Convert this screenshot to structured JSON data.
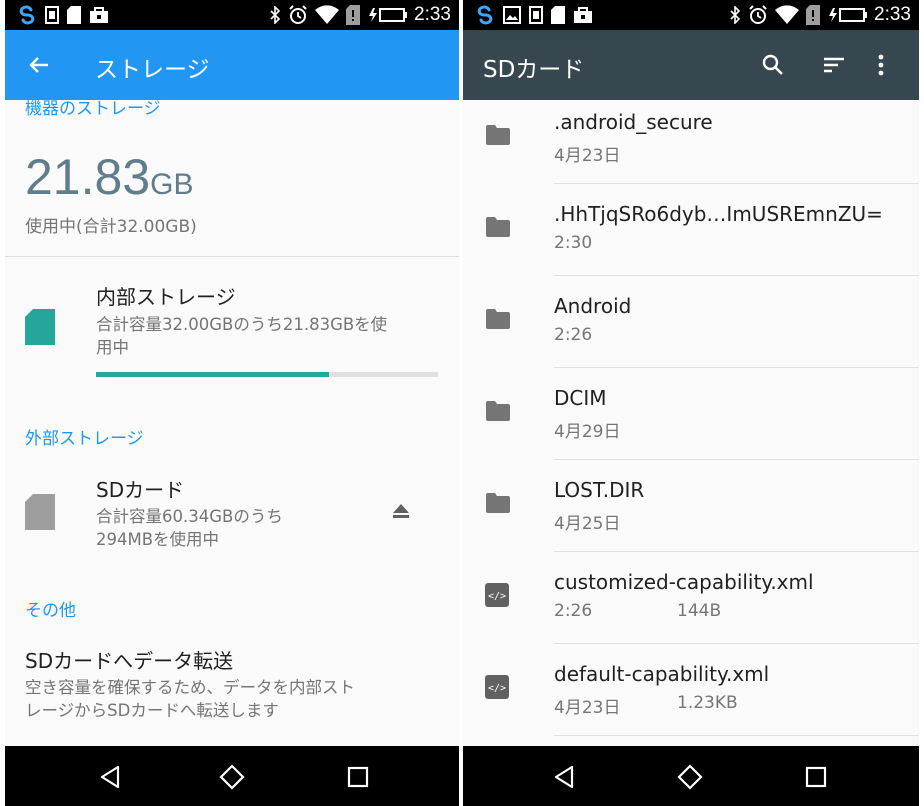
{
  "status_bar": {
    "time": "2:33"
  },
  "left": {
    "appbar": {
      "title": "ストレージ"
    },
    "device_section": {
      "label": "機器のストレージ"
    },
    "usage": {
      "value": "21.83",
      "unit": "GB",
      "caption": "使用中(合計32.00GB)"
    },
    "internal": {
      "title": "内部ストレージ",
      "subtitle_line1": "合計容量32.00GBのうち21.83GBを使",
      "subtitle_line2": "用中",
      "used_fraction": 0.6822
    },
    "external_section": {
      "label": "外部ストレージ"
    },
    "sd": {
      "title": "SDカード",
      "subtitle_line1": "合計容量60.34GBのうち",
      "subtitle_line2": "294MBを使用中"
    },
    "other_section": {
      "label": "その他"
    },
    "transfer": {
      "title": "SDカードへデータ転送",
      "subtitle_line1": "空き容量を確保するため、データを内部スト",
      "subtitle_line2": "レージからSDカードへ転送します"
    }
  },
  "right": {
    "appbar": {
      "title": "SDカード"
    },
    "files": [
      {
        "name": ".android_secure",
        "date": "4月23日",
        "size": "",
        "icon": "folder-icon"
      },
      {
        "name": ".HhTjqSRo6dyb…ImUSREmnZU=",
        "date": "2:30",
        "size": "",
        "icon": "folder-icon"
      },
      {
        "name": "Android",
        "date": "2:26",
        "size": "",
        "icon": "folder-icon"
      },
      {
        "name": "DCIM",
        "date": "4月29日",
        "size": "",
        "icon": "folder-icon"
      },
      {
        "name": "LOST.DIR",
        "date": "4月25日",
        "size": "",
        "icon": "folder-icon"
      },
      {
        "name": "customized-capability.xml",
        "date": "2:26",
        "size": "144B",
        "icon": "xml-file-icon"
      },
      {
        "name": "default-capability.xml",
        "date": "4月23日",
        "size": "1.23KB",
        "icon": "xml-file-icon"
      }
    ]
  },
  "colors": {
    "primary_blue": "#2196f3",
    "dark_appbar": "#37474f",
    "teal_accent": "#26a69a",
    "number_gray": "#607d8b"
  }
}
